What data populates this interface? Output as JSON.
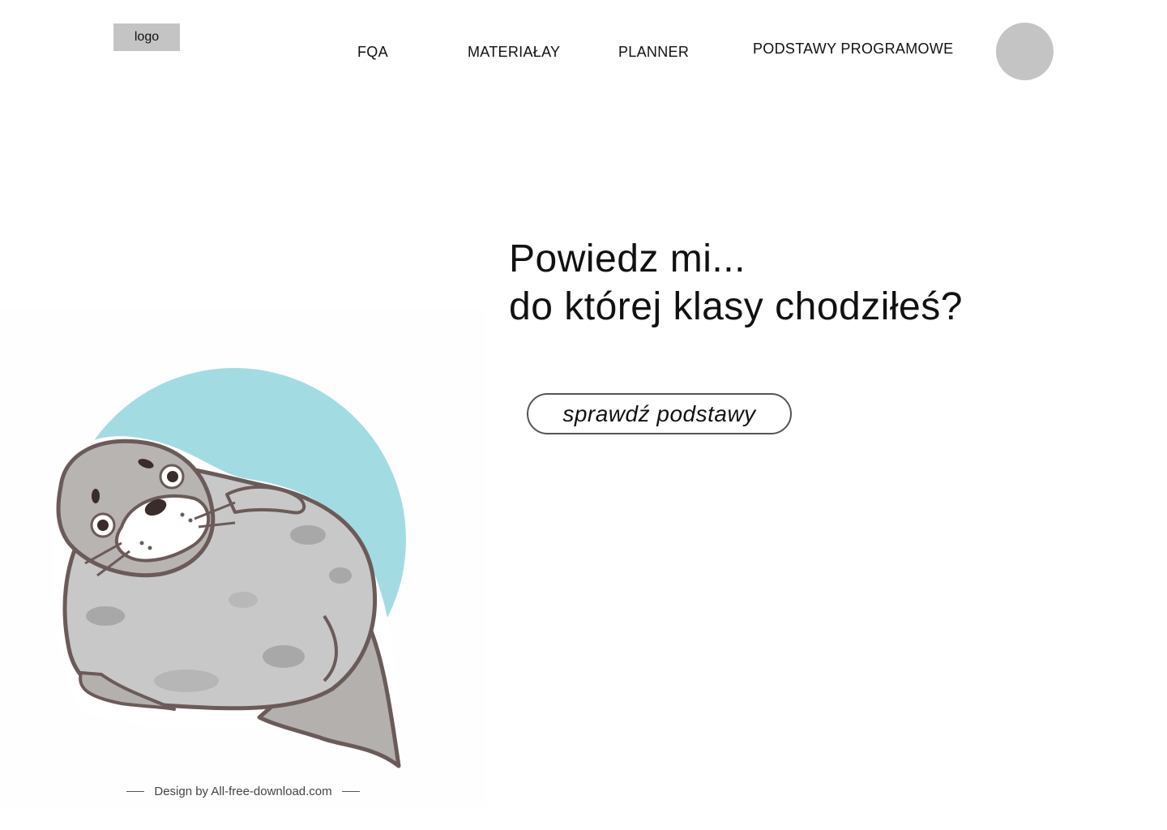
{
  "header": {
    "logo_label": "logo",
    "nav": {
      "fqa": "FQA",
      "materialy": "MATERIAŁAY",
      "planner": "PLANNER",
      "podstawy": "PODSTAWY PROGRAMOWE"
    }
  },
  "hero": {
    "line1": "Powiedz mi...",
    "line2": "do której klasy chodziłeś?",
    "cta_label": "sprawdź podstawy"
  },
  "illustration": {
    "credit": "Design by All-free-download.com",
    "colors": {
      "circle": "#a3dbe3",
      "outline": "#6b5b58",
      "body": "#c8c8c8",
      "spots": "#a8a8a8"
    }
  }
}
